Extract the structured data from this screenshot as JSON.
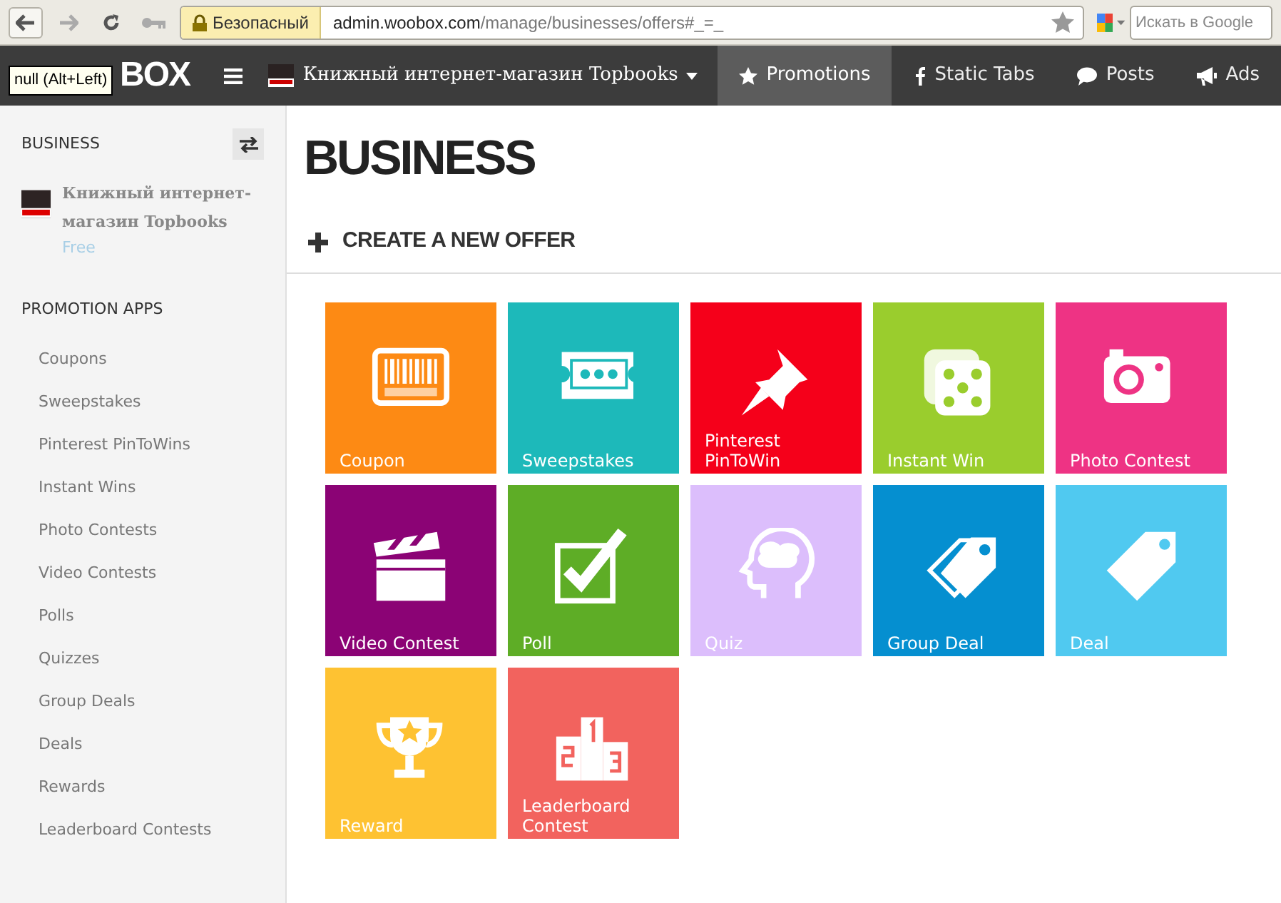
{
  "browser": {
    "security_label": "Безопасный",
    "url_host": "admin.woobox.com",
    "url_path": "/manage/businesses/offers#_=_",
    "search_placeholder": "Искать в Google",
    "tooltip": "null (Alt+Left)"
  },
  "navbar": {
    "logo": "BOX",
    "account": "Книжный интернет-магазин Topbooks",
    "tabs": [
      {
        "label": "Promotions",
        "kind": "star",
        "selected": true
      },
      {
        "label": "Static Tabs",
        "kind": "facebook",
        "selected": false
      },
      {
        "label": "Posts",
        "kind": "bubble",
        "selected": false
      },
      {
        "label": "Ads",
        "kind": "megaphone",
        "selected": false
      }
    ]
  },
  "sidebar": {
    "heading": "BUSINESS",
    "business_name": "Книжный интернет-магазин Topbooks",
    "plan": "Free",
    "section": "PROMOTION APPS",
    "items": [
      "Coupons",
      "Sweepstakes",
      "Pinterest PinToWins",
      "Instant Wins",
      "Photo Contests",
      "Video Contests",
      "Polls",
      "Quizzes",
      "Group Deals",
      "Deals",
      "Rewards",
      "Leaderboard Contests"
    ]
  },
  "main": {
    "title": "BUSINESS",
    "create_label": "CREATE A NEW OFFER",
    "tiles": [
      {
        "label": "Coupon",
        "kind": "barcode",
        "color": "#fd8a14"
      },
      {
        "label": "Sweepstakes",
        "kind": "ticket",
        "color": "#1db9ba"
      },
      {
        "label": "Pinterest PinToWin",
        "kind": "pin",
        "color": "#f5001a"
      },
      {
        "label": "Instant Win",
        "kind": "dice",
        "color": "#9acd2d"
      },
      {
        "label": "Photo Contest",
        "kind": "camera",
        "color": "#ee3384"
      },
      {
        "label": "Video Contest",
        "kind": "clapper",
        "color": "#8b0375"
      },
      {
        "label": "Poll",
        "kind": "checkbox",
        "color": "#5ead26"
      },
      {
        "label": "Quiz",
        "kind": "head",
        "color": "#dcbefc"
      },
      {
        "label": "Group Deal",
        "kind": "tags",
        "color": "#058fd0"
      },
      {
        "label": "Deal",
        "kind": "tag",
        "color": "#50c9f0"
      },
      {
        "label": "Reward",
        "kind": "trophy",
        "color": "#fec232"
      },
      {
        "label": "Leaderboard Contest",
        "kind": "podium",
        "color": "#f2635e"
      }
    ]
  }
}
